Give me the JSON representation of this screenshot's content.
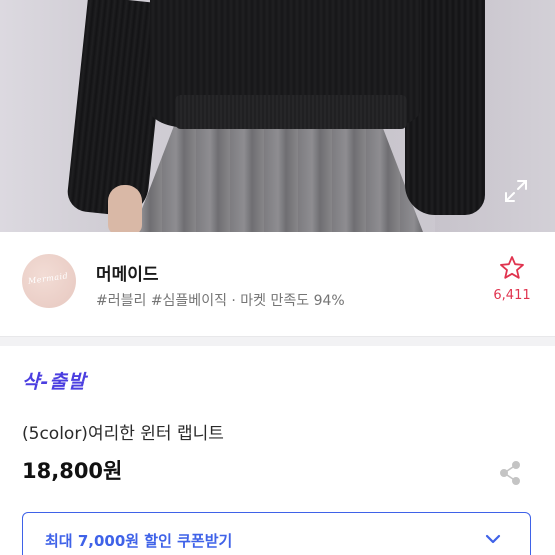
{
  "seller": {
    "name": "머메이드",
    "logo_text": "Mermaid",
    "tags": "#러블리 #심플베이직 · 마켓 만족도 94%",
    "favorites_count": "6,411"
  },
  "product": {
    "brand_logo": "샥-출발",
    "name": "(5color)여리한 윈터 랩니트",
    "price": "18,800원"
  },
  "coupon": {
    "label": "최대 7,000원 할인 쿠폰받기"
  },
  "icons": {
    "expand": "expand-icon",
    "star": "star-icon",
    "share": "share-icon",
    "chevron": "chevron-down-icon"
  },
  "colors": {
    "accent_blue": "#3f62e8",
    "favorite_red": "#e0344f",
    "brand_purple": "#4b3ee0"
  }
}
